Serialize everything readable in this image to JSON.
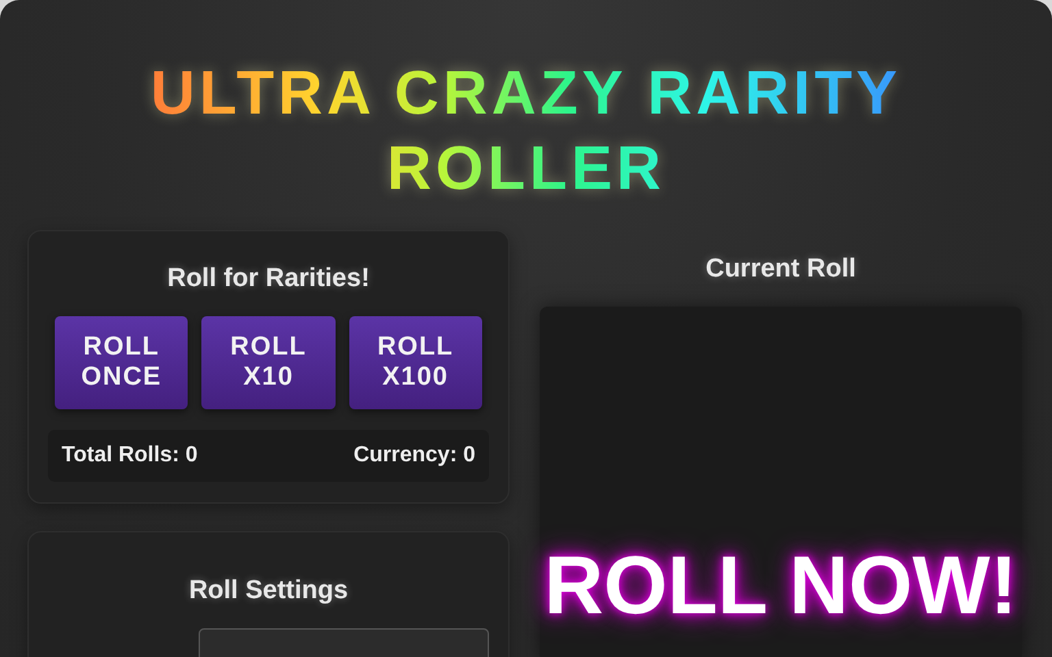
{
  "title": "ULTRA CRAZY RARITY ROLLER",
  "roll_panel": {
    "heading": "Roll for Rarities!",
    "buttons": [
      "ROLL ONCE",
      "ROLL X10",
      "ROLL X100"
    ],
    "stats": [
      "Total Rolls: 0",
      "Currency: 0"
    ]
  },
  "settings_panel": {
    "heading": "Roll Settings"
  },
  "current_roll": {
    "heading": "Current Roll",
    "display": "ROLL NOW!"
  }
}
